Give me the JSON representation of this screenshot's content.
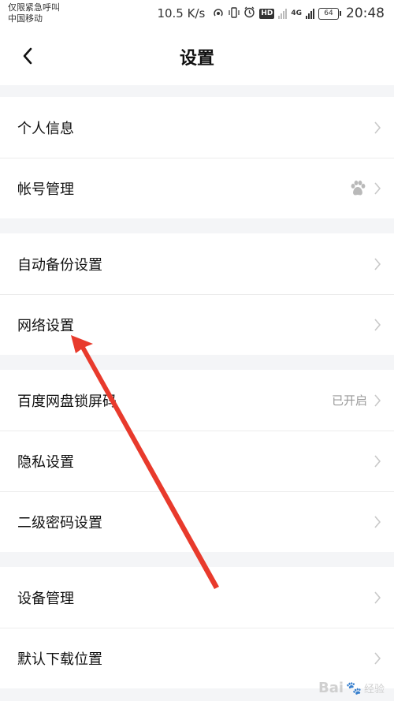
{
  "status_bar": {
    "carrier_line1": "仅限紧急呼叫",
    "carrier_line2": "中国移动",
    "net_speed": "10.5 K/s",
    "hd_label": "HD",
    "network_type": "4G",
    "battery_level": "64",
    "time": "20:48"
  },
  "header": {
    "title": "设置"
  },
  "sections": [
    {
      "rows": [
        {
          "label": "个人信息"
        },
        {
          "label": "帐号管理",
          "badge_icon": "baidu-paw-icon"
        }
      ]
    },
    {
      "rows": [
        {
          "label": "自动备份设置"
        },
        {
          "label": "网络设置"
        }
      ]
    },
    {
      "rows": [
        {
          "label": "百度网盘锁屏码",
          "value": "已开启"
        },
        {
          "label": "隐私设置"
        },
        {
          "label": "二级密码设置"
        }
      ]
    },
    {
      "rows": [
        {
          "label": "设备管理"
        },
        {
          "label": "默认下载位置"
        }
      ]
    }
  ],
  "watermark": {
    "text": "Bai",
    "suffix": "经验"
  },
  "colors": {
    "background": "#f4f5f7",
    "row_background": "#ffffff",
    "annotation_arrow": "#e83a2c"
  }
}
